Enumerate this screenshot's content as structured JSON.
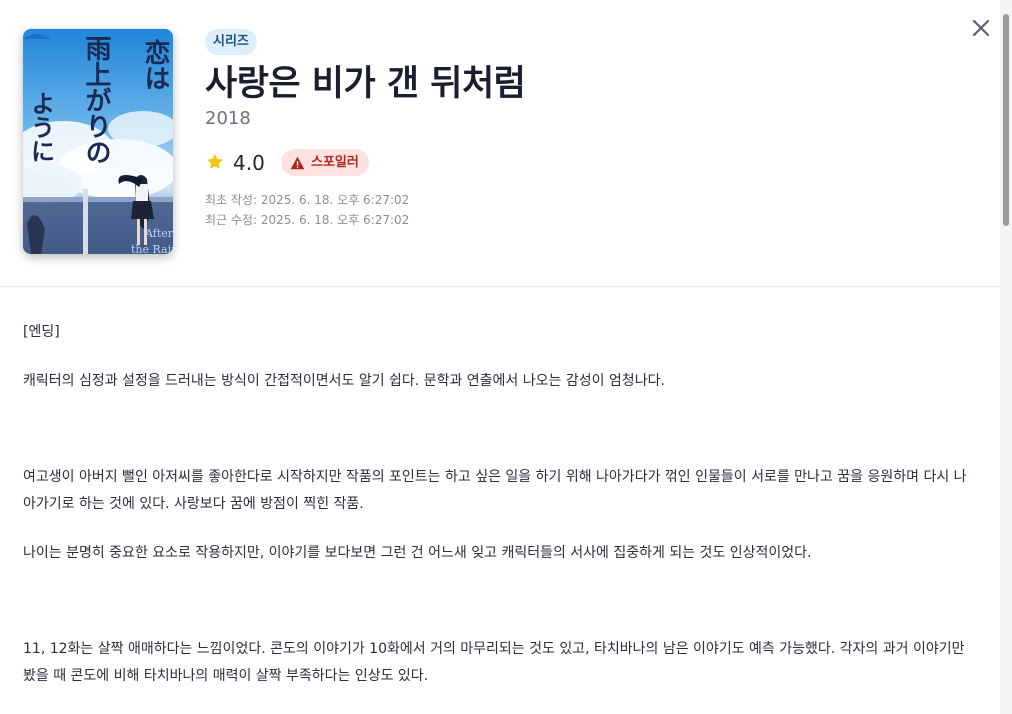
{
  "header": {
    "badge": "시리즈",
    "title": "사랑은 비가 갠 뒤처럼",
    "year": "2018",
    "rating": "4.0",
    "spoiler_label": "스포일러",
    "created": "최초 작성: 2025. 6. 18. 오후 6:27:02",
    "updated": "최근 수정: 2025. 6. 18. 오후 6:27:02"
  },
  "cover": {
    "title_col1": "恋は",
    "title_col2": "雨上がりの",
    "title_col3": "ように",
    "english_line1": "After",
    "english_line2": "the Rain"
  },
  "review": {
    "p1": "[엔딩]",
    "p2": "캐릭터의 심정과 설정을 드러내는 방식이 간접적이면서도 알기 쉽다. 문학과 연출에서 나오는 감성이 엄청나다.",
    "p3": "여고생이 아버지 뻘인 아저씨를 좋아한다로 시작하지만 작품의 포인트는 하고 싶은 일을 하기 위해 나아가다가 꺾인 인물들이 서로를 만나고 꿈을 응원하며 다시 나아가기로 하는 것에 있다. 사랑보다 꿈에 방점이 찍힌 작품.",
    "p4": "나이는 분명히 중요한 요소로 작용하지만, 이야기를 보다보면 그런 건 어느새 잊고 캐릭터들의 서사에 집중하게 되는 것도 인상적이었다.",
    "p5": "11, 12화는 살짝 애매하다는 느낌이었다. 콘도의 이야기가 10화에서 거의 마무리되는 것도 있고, 타치바나의 남은 이야기도 예측 가능했다. 각자의 과거 이야기만 봤을 때 콘도에 비해 타치바나의 매력이 살짝 부족하다는 인상도 있다."
  },
  "icons": {
    "close": "close-icon",
    "star": "star-icon",
    "warning": "warning-icon"
  },
  "colors": {
    "badge_bg": "#dfeefb",
    "badge_text": "#1e4f86",
    "star": "#f5c518",
    "spoiler_bg": "#fde2e2",
    "spoiler_text": "#b3261e"
  }
}
